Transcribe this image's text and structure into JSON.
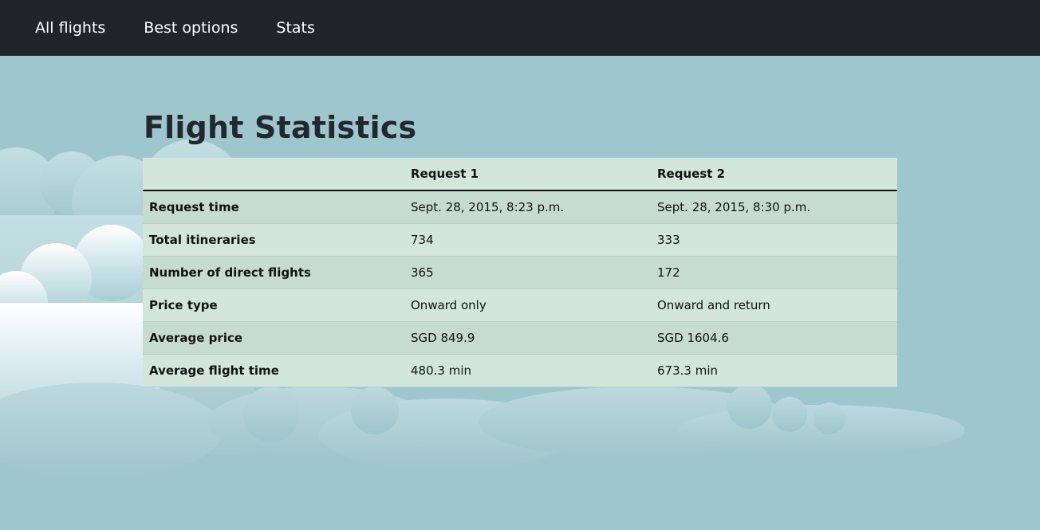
{
  "nav": {
    "items": [
      {
        "label": "All flights"
      },
      {
        "label": "Best options"
      },
      {
        "label": "Stats"
      }
    ]
  },
  "page": {
    "title": "Flight Statistics"
  },
  "table": {
    "headers": [
      "",
      "Request 1",
      "Request 2"
    ],
    "rows": [
      {
        "label": "Request time",
        "request1": "Sept. 28, 2015, 8:23 p.m.",
        "request2": "Sept. 28, 2015, 8:30 p.m."
      },
      {
        "label": "Total itineraries",
        "request1": "734",
        "request2": "333"
      },
      {
        "label": "Number of direct flights",
        "request1": "365",
        "request2": "172"
      },
      {
        "label": "Price type",
        "request1": "Onward only",
        "request2": "Onward and return"
      },
      {
        "label": "Average price",
        "request1": "SGD 849.9",
        "request2": "SGD 1604.6"
      },
      {
        "label": "Average flight time",
        "request1": "480.3 min",
        "request2": "673.3 min"
      }
    ]
  },
  "colors": {
    "navbar": "#212429",
    "background": "#9ec6cd",
    "row_odd": "#c6dcd2",
    "row_even": "#d2e6dc"
  }
}
